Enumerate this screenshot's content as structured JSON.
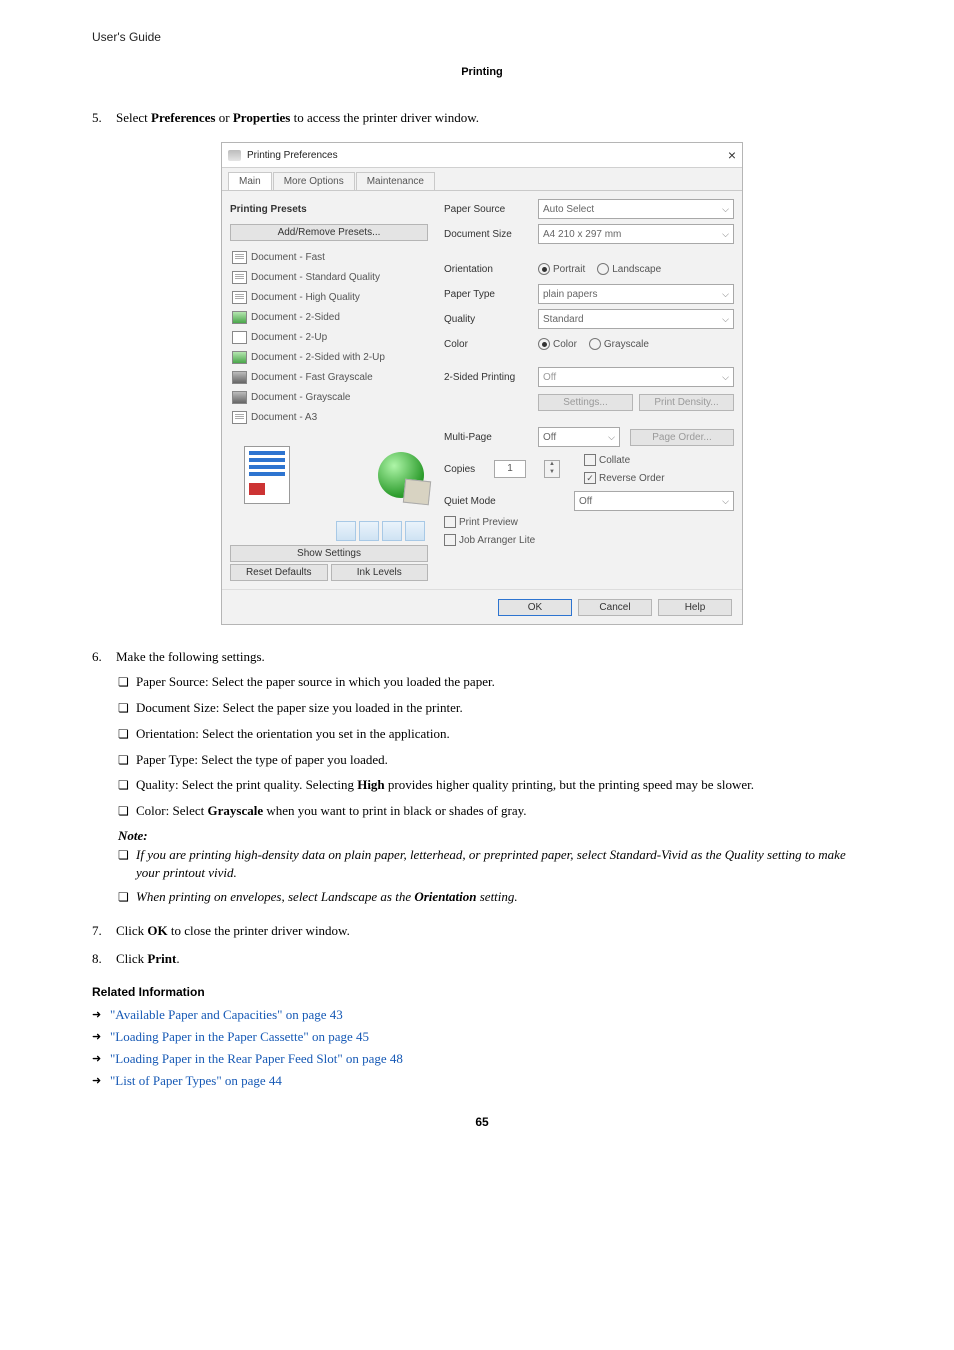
{
  "header": "User's Guide",
  "section": "Printing",
  "step5": {
    "num": "5.",
    "text_a": "Select ",
    "b1": "Preferences",
    "mid": " or ",
    "b2": "Properties",
    "text_b": " to access the printer driver window."
  },
  "dlg": {
    "title": "Printing Preferences",
    "tabs": [
      "Main",
      "More Options",
      "Maintenance"
    ],
    "presets_title": "Printing Presets",
    "add_remove": "Add/Remove Presets...",
    "presets": [
      "Document - Fast",
      "Document - Standard Quality",
      "Document - High Quality",
      "Document - 2-Sided",
      "Document - 2-Up",
      "Document - 2-Sided with 2-Up",
      "Document - Fast Grayscale",
      "Document - Grayscale",
      "Document - A3"
    ],
    "show": "Show Settings",
    "reset": "Reset Defaults",
    "ink": "Ink Levels",
    "paper_source_l": "Paper Source",
    "paper_source_v": "Auto Select",
    "doc_size_l": "Document Size",
    "doc_size_v": "A4 210 x 297 mm",
    "orient_l": "Orientation",
    "orient_a": "Portrait",
    "orient_b": "Landscape",
    "paper_type_l": "Paper Type",
    "paper_type_v": "plain papers",
    "quality_l": "Quality",
    "quality_v": "Standard",
    "color_l": "Color",
    "color_a": "Color",
    "color_b": "Grayscale",
    "twosided_l": "2-Sided Printing",
    "twosided_v": "Off",
    "settings": "Settings...",
    "density": "Print Density...",
    "multi_l": "Multi-Page",
    "multi_v": "Off",
    "page_order": "Page Order...",
    "copies_l": "Copies",
    "copies_v": "1",
    "collate": "Collate",
    "rev": "Reverse Order",
    "quiet_l": "Quiet Mode",
    "quiet_v": "Off",
    "preview": "Print Preview",
    "job": "Job Arranger Lite",
    "ok": "OK",
    "cancel": "Cancel",
    "help": "Help"
  },
  "step6": {
    "num": "6.",
    "text": "Make the following settings.",
    "items": [
      "Paper Source: Select the paper source in which you loaded the paper.",
      "Document Size: Select the paper size you loaded in the printer.",
      "Orientation: Select the orientation you set in the application.",
      "Paper Type: Select the type of paper you loaded."
    ],
    "quality_a": "Quality: Select the print quality. Selecting ",
    "quality_b": "High",
    "quality_c": " provides higher quality printing, but the printing speed may be slower.",
    "color_a": "Color: Select ",
    "color_b": "Grayscale",
    "color_c": " when you want to print in black or shades of gray.",
    "note": "Note:",
    "note1": "If you are printing high-density data on plain paper, letterhead, or preprinted paper, select Standard-Vivid as the Quality setting to make your printout vivid.",
    "note2_a": "When printing on envelopes, select Landscape as the ",
    "note2_b": "Orientation",
    "note2_c": " setting."
  },
  "step7": {
    "num": "7.",
    "a": "Click ",
    "b": "OK",
    "c": " to close the printer driver window."
  },
  "step8": {
    "num": "8.",
    "a": "Click ",
    "b": "Print",
    "c": "."
  },
  "rel_title": "Related Information",
  "links": [
    "\"Available Paper and Capacities\" on page 43",
    "\"Loading Paper in the Paper Cassette\" on page 45",
    "\"Loading Paper in the Rear Paper Feed Slot\" on page 48",
    "\"List of Paper Types\" on page 44"
  ],
  "page_num": "65"
}
